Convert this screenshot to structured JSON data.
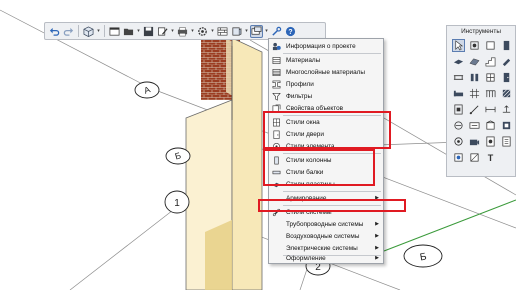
{
  "grid_labels": [
    "A",
    "Б",
    "1",
    "2",
    "Б"
  ],
  "toolbar": {
    "buttons": [
      "undo-icon",
      "redo-icon",
      "cube-view-icon",
      "select-icon",
      "open-folder-icon",
      "save-icon",
      "edit-icon",
      "print-icon",
      "settings-icon",
      "wall-icon",
      "object-icon",
      "styles-icon",
      "wrench-icon",
      "help-icon"
    ]
  },
  "menu": {
    "items": [
      {
        "label": "Информация о проекте",
        "icon": "project-info-icon"
      },
      {
        "label": "Материалы",
        "icon": "materials-icon"
      },
      {
        "label": "Многослойные материалы",
        "icon": "layered-materials-icon"
      },
      {
        "label": "Профили",
        "icon": "profiles-icon"
      },
      {
        "label": "Фильтры",
        "icon": "filters-icon"
      },
      {
        "label": "Свойства объектов",
        "icon": "object-properties-icon"
      },
      {
        "label": "Стили окна",
        "icon": "window-styles-icon"
      },
      {
        "label": "Стили двери",
        "icon": "door-styles-icon"
      },
      {
        "label": "Стили элемента",
        "icon": "element-styles-icon"
      },
      {
        "label": "Стили колонны",
        "icon": "column-styles-icon"
      },
      {
        "label": "Стили балки",
        "icon": "beam-styles-icon"
      },
      {
        "label": "Стили пластины",
        "icon": "plate-styles-icon"
      },
      {
        "label": "Армирование",
        "submenu": true
      },
      {
        "label": "Стили системы",
        "icon": "system-styles-icon"
      },
      {
        "label": "Трубопроводные системы",
        "submenu": true
      },
      {
        "label": "Воздуховодные системы",
        "submenu": true
      },
      {
        "label": "Электрические системы",
        "submenu": true
      },
      {
        "label": "Оформление",
        "submenu": true
      }
    ]
  },
  "palette": {
    "title": "Инструменты",
    "text_tool": "T",
    "tools": [
      "pointer-icon",
      "rotate-icon",
      "box-icon",
      "wall-tool-icon",
      "slab-icon",
      "roof-icon",
      "stair-icon",
      "paint-icon",
      "beam-tool-icon",
      "column-tool-icon",
      "window-tool-icon",
      "door-tool-icon",
      "furniture-icon",
      "grid-tool-icon",
      "railing-icon",
      "hatch-icon",
      "opening-icon",
      "line-tool-icon",
      "dimension-icon",
      "level-icon",
      "room-icon",
      "label-icon",
      "elevation-icon",
      "section-icon",
      "detail-icon",
      "camera-icon",
      "view-icon",
      "sheet-icon",
      "sun-icon",
      "light-icon",
      "text-tool-icon"
    ]
  }
}
